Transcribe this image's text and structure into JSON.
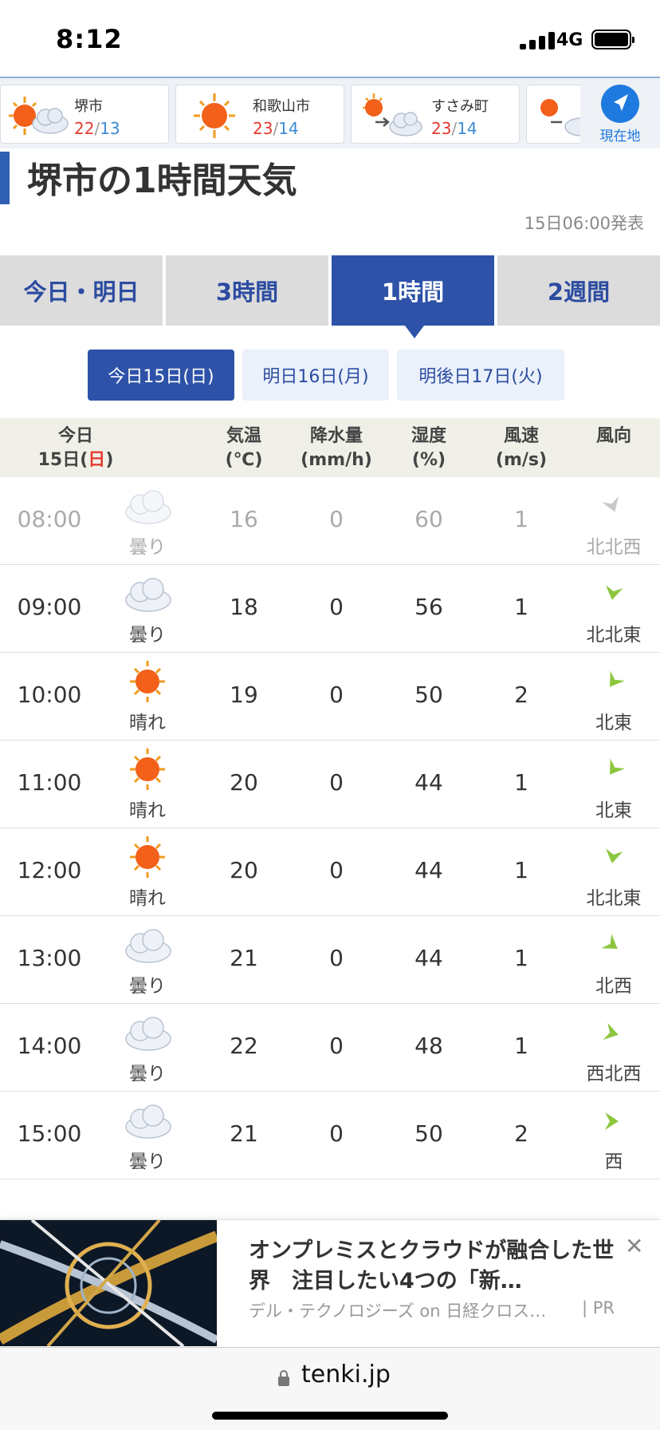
{
  "status_bar": {
    "time": "8:12",
    "network": "4G"
  },
  "cities": [
    {
      "name": "堺市",
      "high": "22",
      "low": "13",
      "icon": "sun-cloud-icon"
    },
    {
      "name": "和歌山市",
      "high": "23",
      "low": "14",
      "icon": "sun-icon"
    },
    {
      "name": "すさみ町",
      "high": "23",
      "low": "14",
      "icon": "sun-then-cloud-icon"
    }
  ],
  "temp_separator": "/",
  "current_location": {
    "label": "現在地",
    "icon": "navigation-arrow-icon"
  },
  "page_title": "堺市の1時間天気",
  "issued": "15日06:00発表",
  "tabs": [
    "今日・明日",
    "3時間",
    "1時間",
    "2週間"
  ],
  "active_tab": "1時間",
  "days": [
    "今日15日(日)",
    "明日16日(月)",
    "明後日17日(火)"
  ],
  "active_day": "今日15日(日)",
  "table_header": {
    "date_line1": "今日",
    "date_line2_prefix": "15日(",
    "date_line2_weekday": "日",
    "date_line2_suffix": ")",
    "temp": "気温",
    "temp_unit": "(℃)",
    "precip": "降水量",
    "precip_unit": "(mm/h)",
    "humidity": "湿度",
    "humidity_unit": "(%)",
    "wind_speed": "風速",
    "wind_speed_unit": "(m/s)",
    "wind_dir": "風向"
  },
  "rows": [
    {
      "time": "08:00",
      "weather": "曇り",
      "icon": "cloud-icon",
      "temp": "16",
      "precip": "0",
      "humidity": "60",
      "wind_speed": "1",
      "wind_dir": "北北西",
      "past": true
    },
    {
      "time": "09:00",
      "weather": "曇り",
      "icon": "cloud-icon",
      "temp": "18",
      "precip": "0",
      "humidity": "56",
      "wind_speed": "1",
      "wind_dir": "北北東",
      "past": false
    },
    {
      "time": "10:00",
      "weather": "晴れ",
      "icon": "sun-icon",
      "temp": "19",
      "precip": "0",
      "humidity": "50",
      "wind_speed": "2",
      "wind_dir": "北東",
      "past": false
    },
    {
      "time": "11:00",
      "weather": "晴れ",
      "icon": "sun-icon",
      "temp": "20",
      "precip": "0",
      "humidity": "44",
      "wind_speed": "1",
      "wind_dir": "北東",
      "past": false
    },
    {
      "time": "12:00",
      "weather": "晴れ",
      "icon": "sun-icon",
      "temp": "20",
      "precip": "0",
      "humidity": "44",
      "wind_speed": "1",
      "wind_dir": "北北東",
      "past": false
    },
    {
      "time": "13:00",
      "weather": "曇り",
      "icon": "cloud-icon",
      "temp": "21",
      "precip": "0",
      "humidity": "44",
      "wind_speed": "1",
      "wind_dir": "北西",
      "past": false
    },
    {
      "time": "14:00",
      "weather": "曇り",
      "icon": "cloud-icon",
      "temp": "22",
      "precip": "0",
      "humidity": "48",
      "wind_speed": "1",
      "wind_dir": "西北西",
      "past": false
    },
    {
      "time": "15:00",
      "weather": "曇り",
      "icon": "cloud-icon",
      "temp": "21",
      "precip": "0",
      "humidity": "50",
      "wind_speed": "2",
      "wind_dir": "西",
      "past": false
    }
  ],
  "ad": {
    "headline": "オンプレミスとクラウドが融合した世界　注目したい4つの「新…",
    "source": "デル・テクノロジーズ on 日経クロス…",
    "pr": "| PR",
    "close": "✕"
  },
  "url": "tenki.jp",
  "colors": {
    "accent": "#2d52a8",
    "high_temp": "#e53a2f",
    "low_temp": "#3d8ad6",
    "wind_arrow": "#8cc63f"
  }
}
